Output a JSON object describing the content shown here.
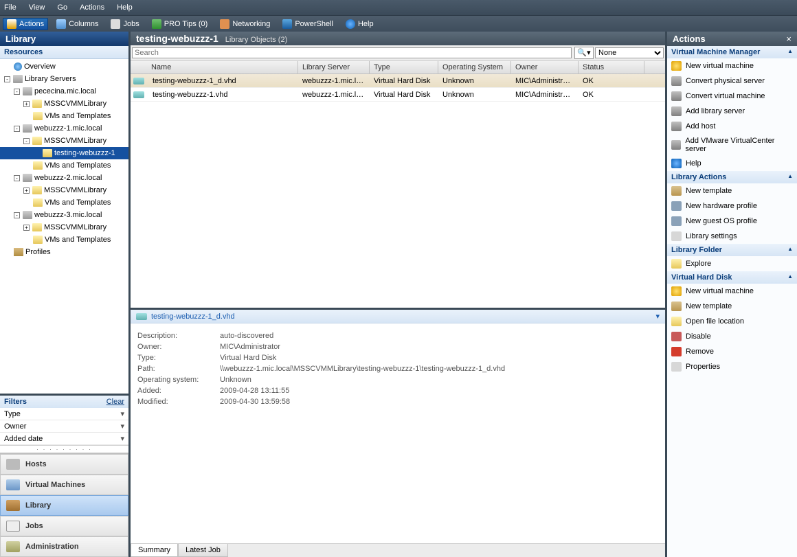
{
  "menu": {
    "file": "File",
    "view": "View",
    "go": "Go",
    "actions": "Actions",
    "help": "Help"
  },
  "toolbar": {
    "actions": "Actions",
    "columns": "Columns",
    "jobs": "Jobs",
    "protips": "PRO Tips (0)",
    "networking": "Networking",
    "powershell": "PowerShell",
    "help": "Help"
  },
  "leftpane": {
    "title": "Library",
    "resources": "Resources",
    "tree": {
      "overview": "Overview",
      "libservers": "Library Servers",
      "srv1": "pececina.mic.local",
      "s1lib": "MSSCVMMLibrary",
      "s1vm": "VMs and Templates",
      "srv2": "webuzzz-1.mic.local",
      "s2lib": "MSSCVMMLibrary",
      "s2folder": "testing-webuzzz-1",
      "s2vm": "VMs and Templates",
      "srv3": "webuzzz-2.mic.local",
      "s3lib": "MSSCVMMLibrary",
      "s3vm": "VMs and Templates",
      "srv4": "webuzzz-3.mic.local",
      "s4lib": "MSSCVMMLibrary",
      "s4vm": "VMs and Templates",
      "profiles": "Profiles"
    },
    "filters": {
      "title": "Filters",
      "clear": "Clear",
      "f1": "Type",
      "f2": "Owner",
      "f3": "Added date"
    },
    "nav": {
      "hosts": "Hosts",
      "vms": "Virtual Machines",
      "library": "Library",
      "jobs": "Jobs",
      "admin": "Administration"
    }
  },
  "center": {
    "title": "testing-webuzzz-1",
    "subtitle": "Library Objects (2)",
    "search_ph": "Search",
    "filter_sel": "None",
    "cols": {
      "name": "Name",
      "lib": "Library Server",
      "type": "Type",
      "os": "Operating System",
      "owner": "Owner",
      "status": "Status"
    },
    "rows": [
      {
        "name": "testing-webuzzz-1_d.vhd",
        "lib": "webuzzz-1.mic.lo...",
        "type": "Virtual Hard Disk",
        "os": "Unknown",
        "owner": "MIC\\Administrator",
        "status": "OK"
      },
      {
        "name": "testing-webuzzz-1.vhd",
        "lib": "webuzzz-1.mic.lo...",
        "type": "Virtual Hard Disk",
        "os": "Unknown",
        "owner": "MIC\\Administrator",
        "status": "OK"
      }
    ],
    "details": {
      "title": "testing-webuzzz-1_d.vhd",
      "k": {
        "desc": "Description:",
        "owner": "Owner:",
        "type": "Type:",
        "path": "Path:",
        "os": "Operating system:",
        "added": "Added:",
        "modified": "Modified:"
      },
      "v": {
        "desc": "auto-discovered",
        "owner": "MIC\\Administrator",
        "type": "Virtual Hard Disk",
        "path": "\\\\webuzzz-1.mic.local\\MSSCVMMLibrary\\testing-webuzzz-1\\testing-webuzzz-1_d.vhd",
        "os": "Unknown",
        "added": "2009-04-28 13:11:55",
        "modified": "2009-04-30 13:59:58"
      }
    },
    "tabs": {
      "summary": "Summary",
      "latest": "Latest Job"
    }
  },
  "right": {
    "title": "Actions",
    "sec1": {
      "title": "Virtual Machine Manager",
      "i1": "New virtual machine",
      "i2": "Convert physical server",
      "i3": "Convert virtual machine",
      "i4": "Add library server",
      "i5": "Add host",
      "i6": "Add VMware VirtualCenter server",
      "i7": "Help"
    },
    "sec2": {
      "title": "Library Actions",
      "i1": "New template",
      "i2": "New hardware profile",
      "i3": "New guest OS profile",
      "i4": "Library settings"
    },
    "sec3": {
      "title": "Library Folder",
      "i1": "Explore"
    },
    "sec4": {
      "title": "Virtual Hard Disk",
      "i1": "New virtual machine",
      "i2": "New template",
      "i3": "Open file location",
      "i4": "Disable",
      "i5": "Remove",
      "i6": "Properties"
    }
  }
}
